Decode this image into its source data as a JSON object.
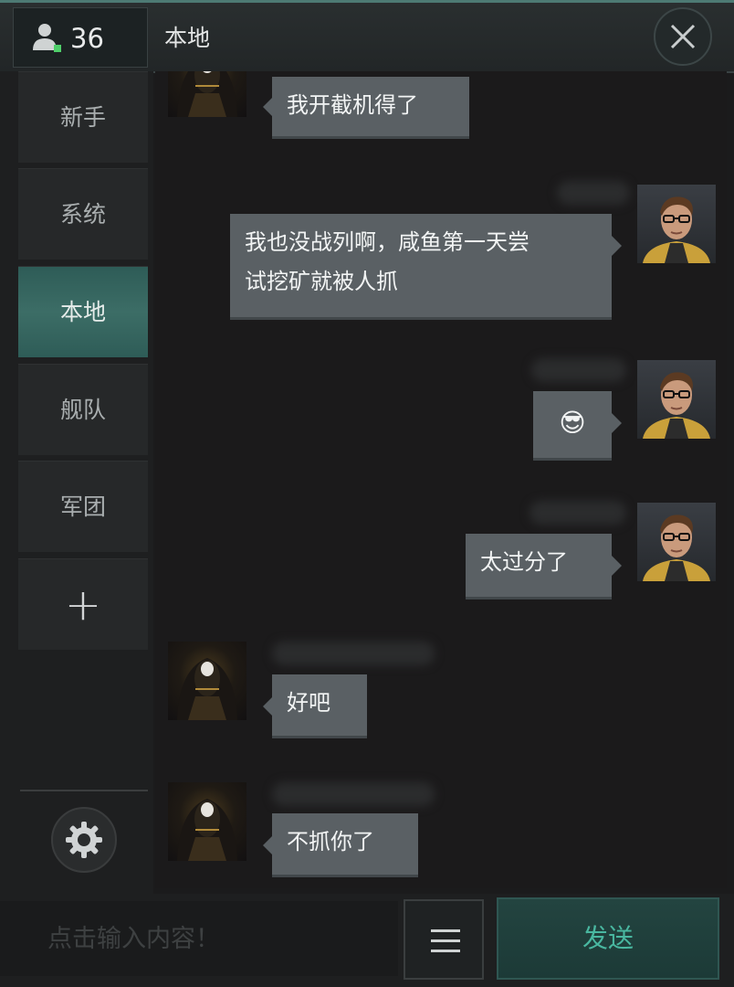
{
  "header": {
    "online_count": "36",
    "channel_title": "本地"
  },
  "sidebar": {
    "tabs": [
      {
        "label": "新手",
        "active": false
      },
      {
        "label": "系统",
        "active": false
      },
      {
        "label": "本地",
        "active": true
      },
      {
        "label": "舰队",
        "active": false
      },
      {
        "label": "军团",
        "active": false
      },
      {
        "label": "+",
        "active": false
      }
    ]
  },
  "messages": [
    {
      "side": "left",
      "text": "我开截机得了"
    },
    {
      "side": "right",
      "text": "我也没战列啊，咸鱼第一天尝",
      "text_line2": "试挖矿就被人抓"
    },
    {
      "side": "right",
      "text": "😎"
    },
    {
      "side": "right",
      "text": "太过分了"
    },
    {
      "side": "left",
      "text": "好吧"
    },
    {
      "side": "left",
      "text": "不抓你了"
    }
  ],
  "composer": {
    "placeholder": "点击输入内容！",
    "send_label": "发送"
  },
  "colors": {
    "accent": "#49b7a0",
    "active_tab": "#3c6d66",
    "bubble": "#5a6064"
  }
}
